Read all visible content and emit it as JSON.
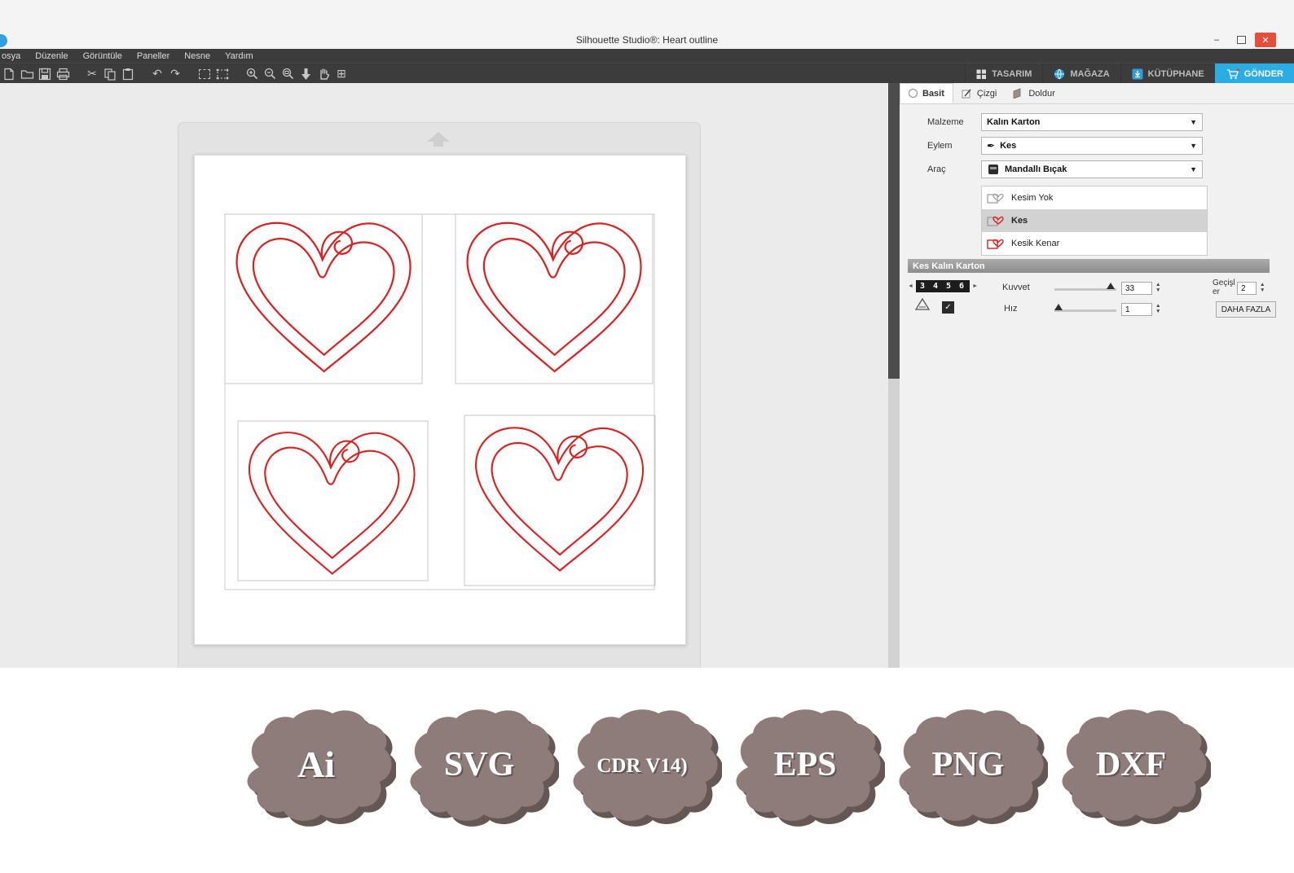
{
  "window": {
    "title": "Silhouette Studio®: Heart outline",
    "minimize": "–",
    "close": "✕"
  },
  "menu": {
    "items": [
      "osya",
      "Düzenle",
      "Görüntüle",
      "Paneller",
      "Nesne",
      "Yardım"
    ]
  },
  "glyphs": {
    "cut": "✂",
    "undo": "↶",
    "redo": "↷",
    "fit": "⊞",
    "down_arrow": "▼",
    "spin_up": "▲",
    "spin_down": "▼",
    "left_small": "◄",
    "right_small": "►",
    "check": "✓",
    "pen": "✒"
  },
  "nav": {
    "tabs": [
      {
        "label": "TASARIM"
      },
      {
        "label": "MAĞAZA"
      },
      {
        "label": "KÜTÜPHANE"
      },
      {
        "label": "GÖNDER"
      }
    ]
  },
  "panel": {
    "tabs": [
      {
        "label": "Basit"
      },
      {
        "label": "Çizgi"
      },
      {
        "label": "Doldur"
      }
    ],
    "fields": [
      {
        "label": "Malzeme",
        "value": "Kalın Karton"
      },
      {
        "label": "Eylem",
        "value": "Kes"
      },
      {
        "label": "Araç",
        "value": "Mandallı Bıçak"
      }
    ],
    "options": [
      {
        "label": "Kesim Yok"
      },
      {
        "label": "Kes"
      },
      {
        "label": "Kesik Kenar"
      }
    ],
    "section": {
      "title": "Kes Kalın Karton"
    },
    "blade": {
      "digits": "3 4 5 6"
    },
    "kuvvet": {
      "label": "Kuvvet",
      "value": "33"
    },
    "hiz": {
      "label": "Hız",
      "value": "1"
    },
    "passes": {
      "label_line1": "Geçişl",
      "label_line2": "er",
      "value": "2"
    },
    "more_button": "DAHA FAZLA"
  },
  "badges": [
    {
      "text": "Ai"
    },
    {
      "text": "SVG"
    },
    {
      "text": "CDR V14)"
    },
    {
      "text": "EPS"
    },
    {
      "text": "PNG"
    },
    {
      "text": "DXF"
    }
  ],
  "colors": {
    "accent_blue": "#2bace2",
    "heart_red": "#dd1f1f",
    "badge": "#8d7c79",
    "badge_shadow": "#655754",
    "close_red": "#e34f3c"
  }
}
